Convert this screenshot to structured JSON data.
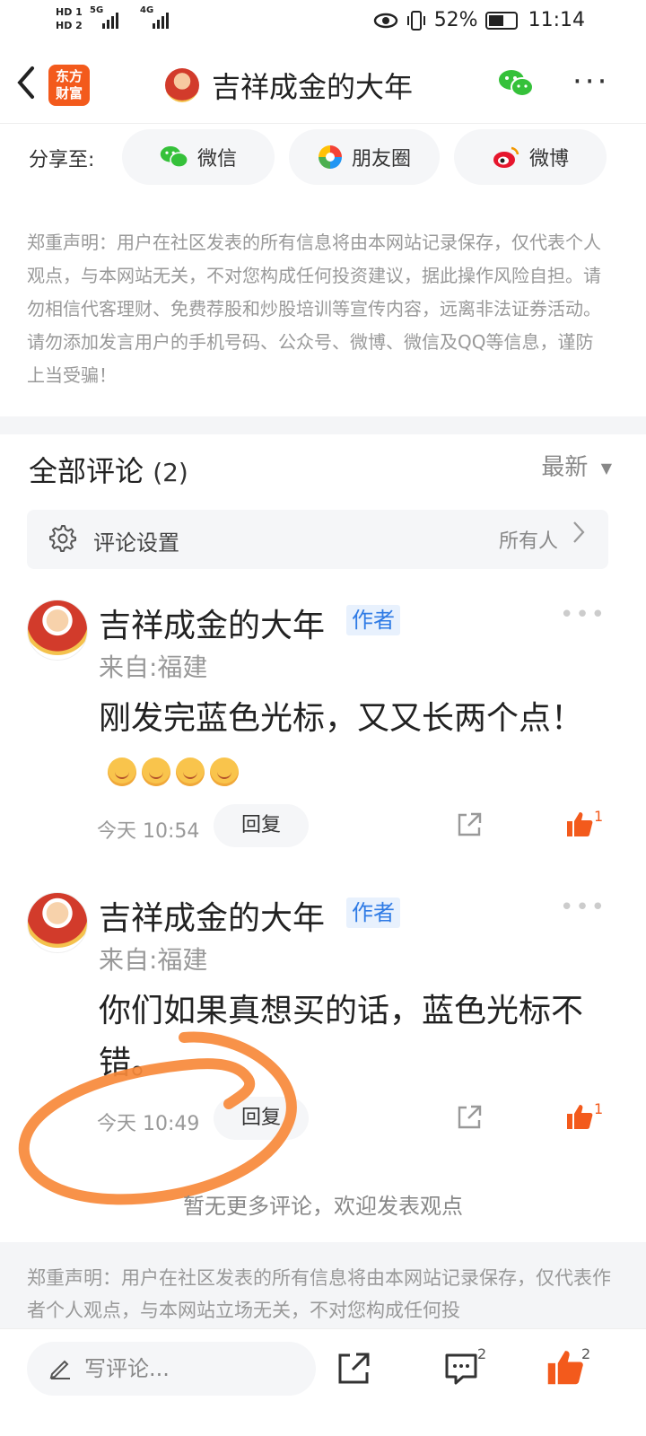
{
  "status_bar": {
    "hd1": "HD 1",
    "hd2": "HD 2",
    "net1": "5G",
    "net2": "4G",
    "battery_pct": "52%",
    "time": "11:14"
  },
  "header": {
    "logo_text_line1": "东方",
    "logo_text_line2": "财富",
    "title": "吉祥成金的大年"
  },
  "share": {
    "label": "分享至:",
    "buttons": [
      {
        "label": "微信",
        "icon": "wechat-icon"
      },
      {
        "label": "朋友圈",
        "icon": "moments-icon"
      },
      {
        "label": "微博",
        "icon": "weibo-icon"
      }
    ]
  },
  "disclaimer_top": "郑重声明：用户在社区发表的所有信息将由本网站记录保存，仅代表个人观点，与本网站无关，不对您构成任何投资建议，据此操作风险自担。请勿相信代客理财、免费荐股和炒股培训等宣传内容，远离非法证券活动。请勿添加发言用户的手机号码、公众号、微博、微信及QQ等信息，谨防上当受骗！",
  "comments_section": {
    "title": "全部评论",
    "count": "(2)",
    "sort_label": "最新",
    "settings_label": "评论设置",
    "settings_value": "所有人"
  },
  "comments": [
    {
      "author": "吉祥成金的大年",
      "badge": "作者",
      "from": "来自:福建",
      "text": "刚发完蓝色光标，又又长两个点！",
      "time": "今天 10:54",
      "reply_label": "回复",
      "likes": "1",
      "emoji_count": 4
    },
    {
      "author": "吉祥成金的大年",
      "badge": "作者",
      "from": "来自:福建",
      "text": "你们如果真想买的话，蓝色光标不错。",
      "time": "今天 10:49",
      "reply_label": "回复",
      "likes": "1",
      "emoji_count": 0
    }
  ],
  "no_more_text": "暂无更多评论，欢迎发表观点",
  "disclaimer_bottom": "郑重声明：用户在社区发表的所有信息将由本网站记录保存，仅代表作者个人观点，与本网站立场无关，不对您构成任何投",
  "bottom_bar": {
    "write_placeholder": "写评论...",
    "comment_count": "2",
    "like_count": "2"
  },
  "colors": {
    "accent": "#f35a1c",
    "badge_bg": "#e8f1fd",
    "badge_text": "#2f7be5",
    "annotation_circle": "#f7893a"
  }
}
